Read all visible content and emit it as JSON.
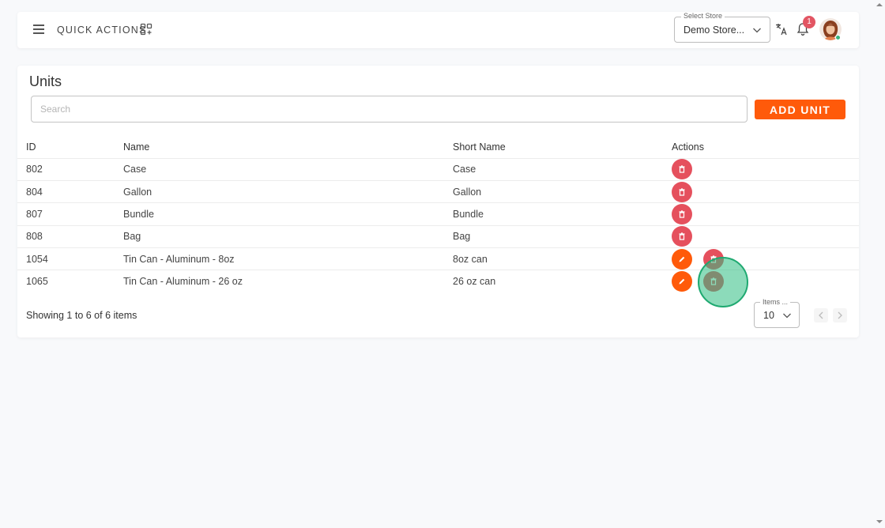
{
  "header": {
    "quick_actions_label": "QUICK ACTIONS",
    "store_select": {
      "legend": "Select Store",
      "value": "Demo Store..."
    },
    "notification_count": "1"
  },
  "main": {
    "title": "Units",
    "search_placeholder": "Search",
    "add_button_label": "ADD UNIT",
    "columns": {
      "id": "ID",
      "name": "Name",
      "short_name": "Short Name",
      "actions": "Actions"
    },
    "rows": [
      {
        "id": "802",
        "name": "Case",
        "short_name": "Case",
        "editable": false
      },
      {
        "id": "804",
        "name": "Gallon",
        "short_name": "Gallon",
        "editable": false
      },
      {
        "id": "807",
        "name": "Bundle",
        "short_name": "Bundle",
        "editable": false
      },
      {
        "id": "808",
        "name": "Bag",
        "short_name": "Bag",
        "editable": false
      },
      {
        "id": "1054",
        "name": "Tin Can - Aluminum - 8oz",
        "short_name": "8oz can",
        "editable": true
      },
      {
        "id": "1065",
        "name": "Tin Can - Aluminum - 26 oz",
        "short_name": "26 oz can",
        "editable": true
      }
    ],
    "footer": {
      "showing_text": "Showing 1 to 6 of 6 items",
      "items_per_page": {
        "legend": "Items ...",
        "value": "10"
      }
    }
  },
  "colors": {
    "accent": "#ff5a0a",
    "delete": "#e5505d",
    "badge": "#e25563",
    "online": "#36b37e",
    "click_indicator": "#2ebe82"
  }
}
